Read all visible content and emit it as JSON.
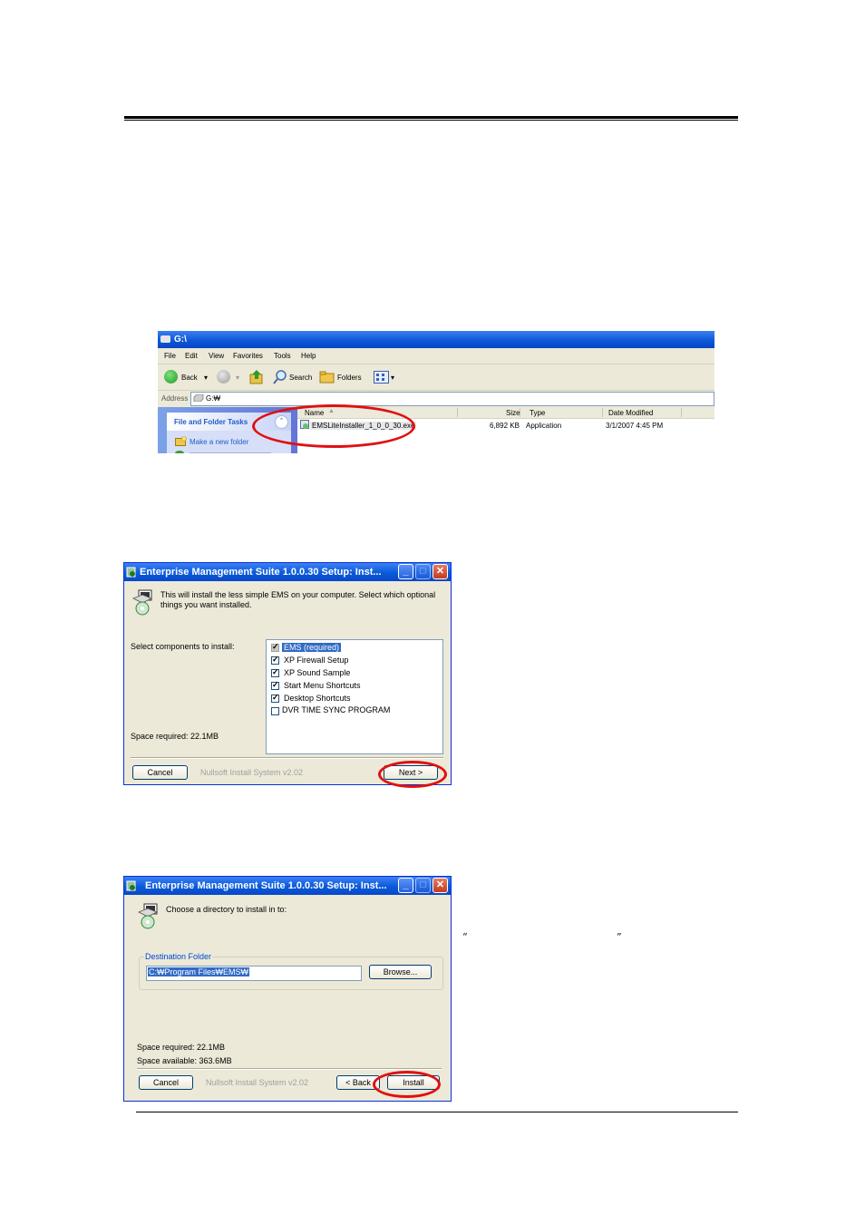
{
  "explorer": {
    "title": "G:\\",
    "menu": [
      "File",
      "Edit",
      "View",
      "Favorites",
      "Tools",
      "Help"
    ],
    "toolbar": {
      "back": "Back",
      "search": "Search",
      "folders": "Folders"
    },
    "address_label": "Address",
    "address_value": "G:₩",
    "tasks_header": "File and Folder Tasks",
    "tasks_item": "Make a new folder",
    "columns": {
      "name": "Name",
      "size": "Size",
      "type": "Type",
      "date": "Date Modified"
    },
    "file": {
      "name": "EMSLiteInstaller_1_0_0_30.exe",
      "size": "6,892 KB",
      "type": "Application",
      "date": "3/1/2007 4:45 PM"
    }
  },
  "dialog1": {
    "title": "Enterprise Management Suite 1.0.0.30 Setup: Inst...",
    "intro": [
      "This will install the less simple EMS on your computer. Select which optional",
      "things you want installed."
    ],
    "select_label": "Select components to install:",
    "components": [
      {
        "label": "EMS (required)",
        "checked": true,
        "disabled": true
      },
      {
        "label": "XP Firewall Setup",
        "checked": true
      },
      {
        "label": "XP Sound Sample",
        "checked": true
      },
      {
        "label": "Start Menu Shortcuts",
        "checked": true
      },
      {
        "label": "Desktop Shortcuts",
        "checked": true
      },
      {
        "label": "DVR TIME SYNC PROGRAM",
        "checked": false
      }
    ],
    "space_required": "Space required: 22.1MB",
    "cancel": "Cancel",
    "brand": "Nullsoft Install System v2.02",
    "next": "Next >"
  },
  "dialog2": {
    "title": "Enterprise Management Suite 1.0.0.30 Setup: Inst...",
    "intro": "Choose a directory to install in to:",
    "group_label": "Destination Folder",
    "path": "C:₩Program Files₩EMS₩",
    "browse": "Browse...",
    "space_required": "Space required: 22.1MB",
    "space_available": "Space available: 363.6MB",
    "cancel": "Cancel",
    "brand": "Nullsoft Install System v2.02",
    "back": "< Back",
    "install": "Install"
  },
  "quotes": {
    "open": "“",
    "close": "”"
  },
  "colors": {
    "highlight": "#e01010",
    "xp_blue": "#0a55d8"
  }
}
